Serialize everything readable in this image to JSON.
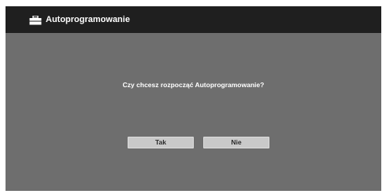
{
  "window": {
    "title": "Autoprogramowanie",
    "icon": "toolbox-icon"
  },
  "dialog": {
    "question": "Czy chcesz rozpocząć Autoprogramowanie?",
    "buttons": {
      "yes_label": "Tak",
      "no_label": "Nie"
    }
  },
  "colors": {
    "titlebar": "#1f1f1f",
    "background": "#6e6e6e",
    "button": "#c9c9c9",
    "text": "#ffffff"
  }
}
